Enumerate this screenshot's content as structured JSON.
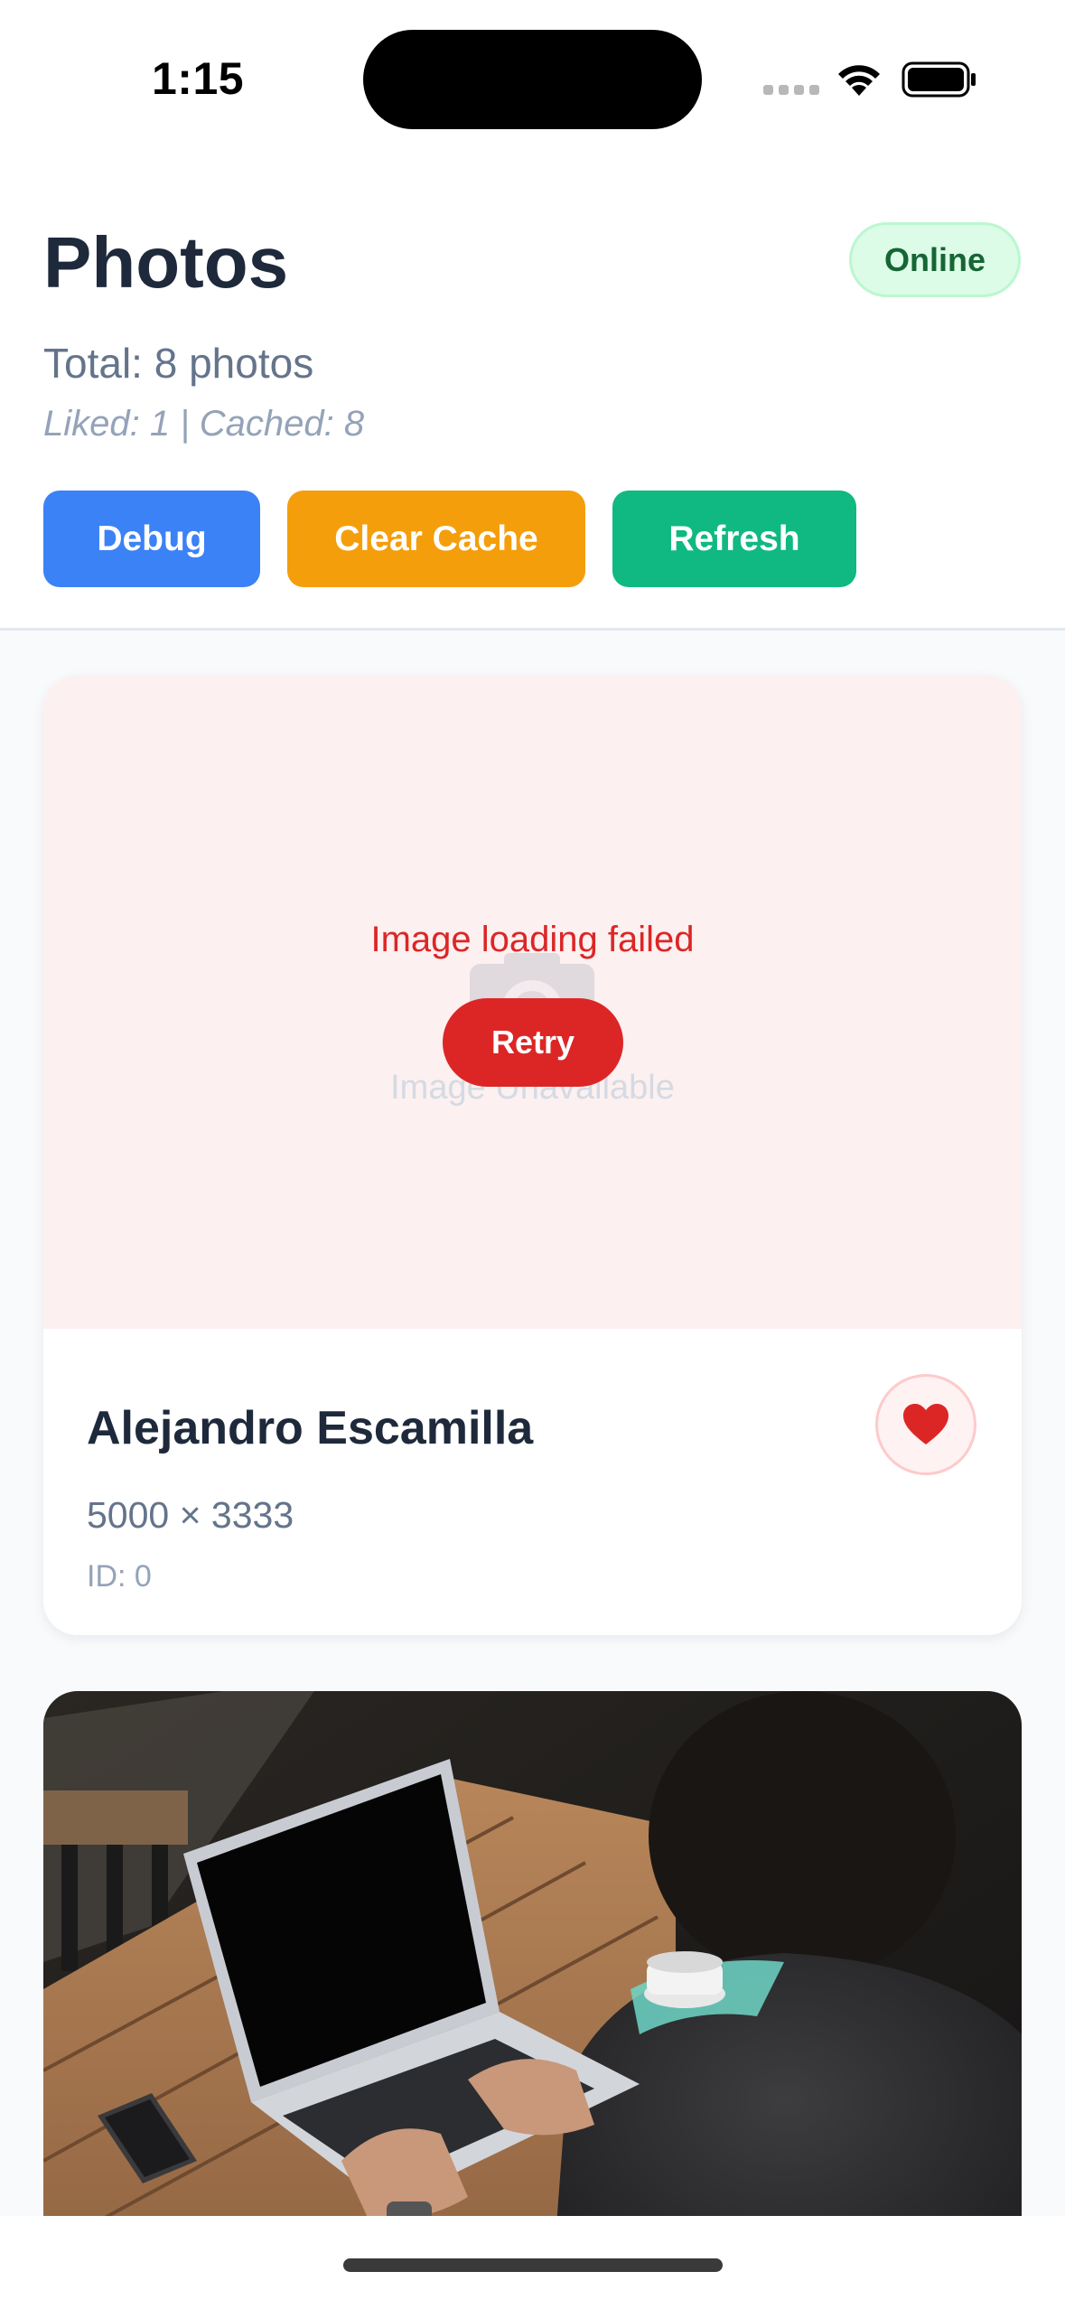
{
  "status_bar": {
    "time": "1:15"
  },
  "header": {
    "title": "Photos",
    "connection_status": "Online",
    "total_text": "Total: 8 photos",
    "stats_text": "Liked: 1 | Cached: 8",
    "buttons": {
      "debug": "Debug",
      "clear_cache": "Clear Cache",
      "refresh": "Refresh"
    }
  },
  "photos": [
    {
      "error_message": "Image loading failed",
      "placeholder_text": "Image Unavailable",
      "retry_label": "Retry",
      "author": "Alejandro Escamilla",
      "dimensions": "5000 × 3333",
      "id_label": "ID: 0",
      "liked": true,
      "like_icon": "heart-icon"
    },
    {
      "image_description_icon": "photo-laptop-desk"
    }
  ],
  "colors": {
    "debug": "#3b82f6",
    "clear_cache": "#f59e0b",
    "refresh": "#10b981",
    "error": "#dc2626",
    "online_bg": "#dcfce7",
    "online_text": "#166534"
  }
}
